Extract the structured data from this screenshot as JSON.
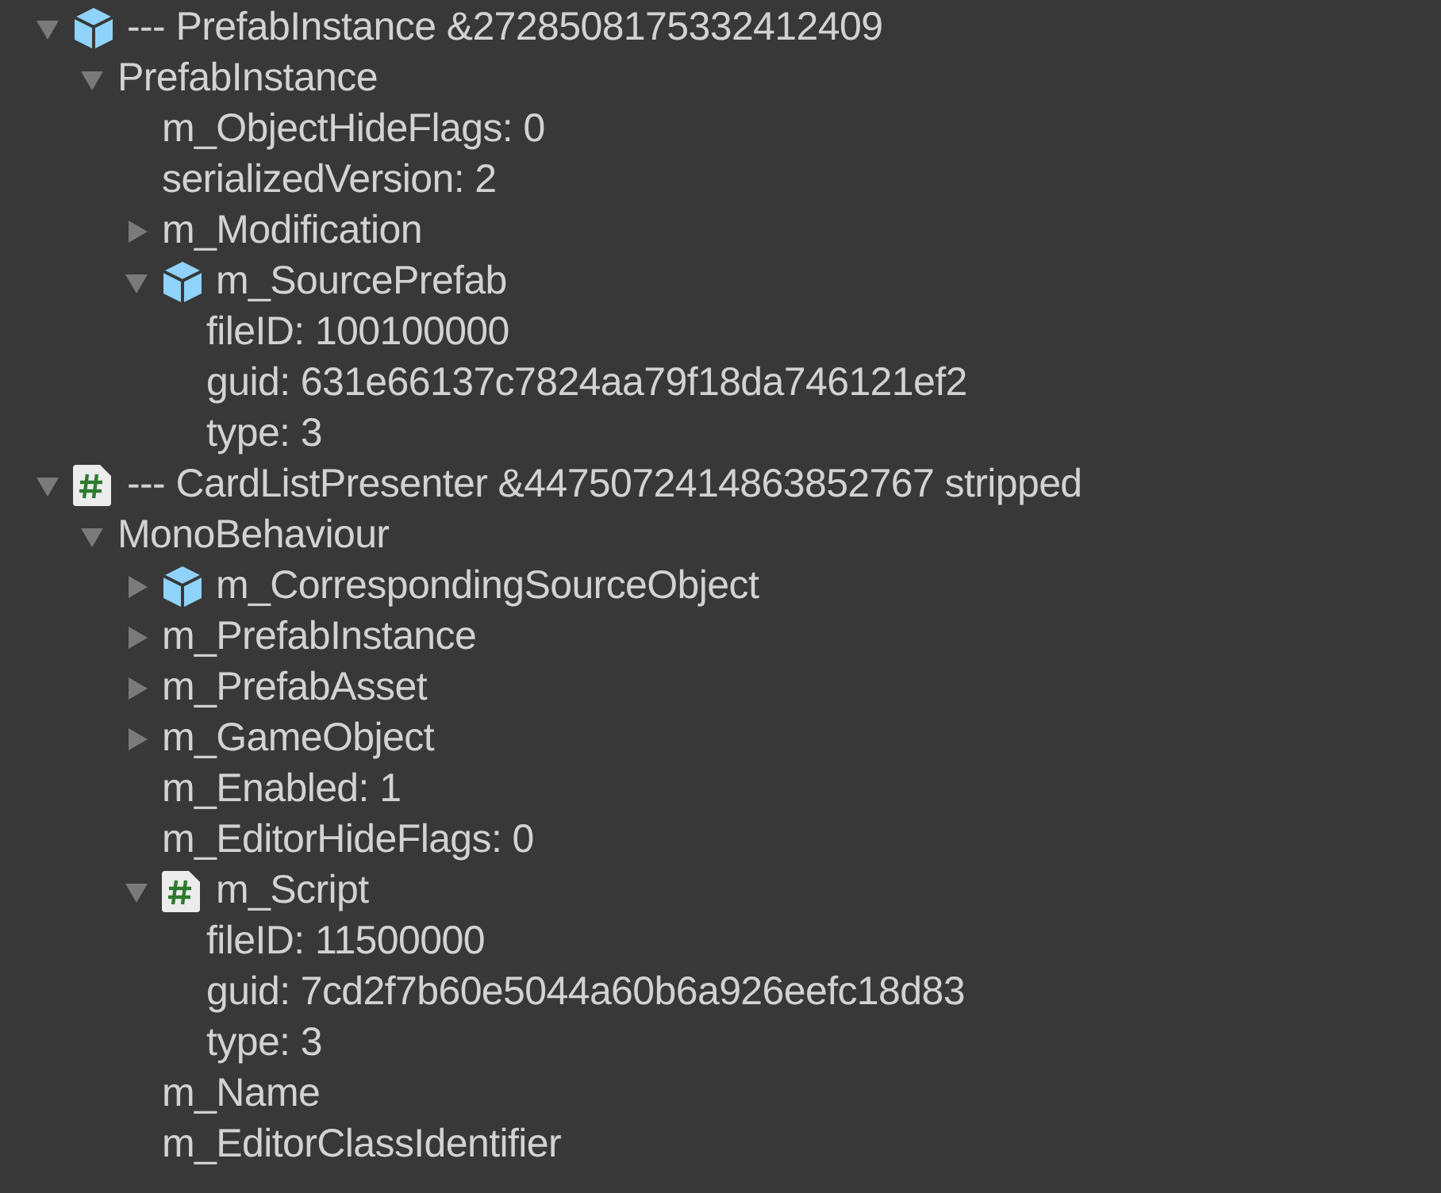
{
  "tree": [
    {
      "label": "--- PrefabInstance &2728508175332412409",
      "kind": "prefab",
      "expanded": true,
      "children": [
        {
          "label": "PrefabInstance",
          "expanded": true,
          "children": [
            {
              "label": "m_ObjectHideFlags: 0"
            },
            {
              "label": "serializedVersion: 2"
            },
            {
              "label": "m_Modification",
              "expanded": false
            },
            {
              "label": "m_SourcePrefab",
              "kind": "prefab",
              "expanded": true,
              "children": [
                {
                  "label": "fileID: 100100000"
                },
                {
                  "label": "guid: 631e66137c7824aa79f18da746121ef2"
                },
                {
                  "label": "type: 3"
                }
              ]
            }
          ]
        }
      ]
    },
    {
      "label": "--- CardListPresenter &4475072414863852767 stripped",
      "kind": "script",
      "expanded": true,
      "children": [
        {
          "label": "MonoBehaviour",
          "expanded": true,
          "children": [
            {
              "label": "m_CorrespondingSourceObject",
              "kind": "prefab",
              "expanded": false
            },
            {
              "label": "m_PrefabInstance",
              "expanded": false
            },
            {
              "label": "m_PrefabAsset",
              "expanded": false
            },
            {
              "label": "m_GameObject",
              "expanded": false
            },
            {
              "label": "m_Enabled: 1"
            },
            {
              "label": "m_EditorHideFlags: 0"
            },
            {
              "label": "m_Script",
              "kind": "script",
              "expanded": true,
              "children": [
                {
                  "label": "fileID: 11500000"
                },
                {
                  "label": "guid: 7cd2f7b60e5044a60b6a926eefc18d83"
                },
                {
                  "label": "type: 3"
                }
              ]
            },
            {
              "label": "m_Name"
            },
            {
              "label": "m_EditorClassIdentifier"
            }
          ]
        }
      ]
    }
  ]
}
